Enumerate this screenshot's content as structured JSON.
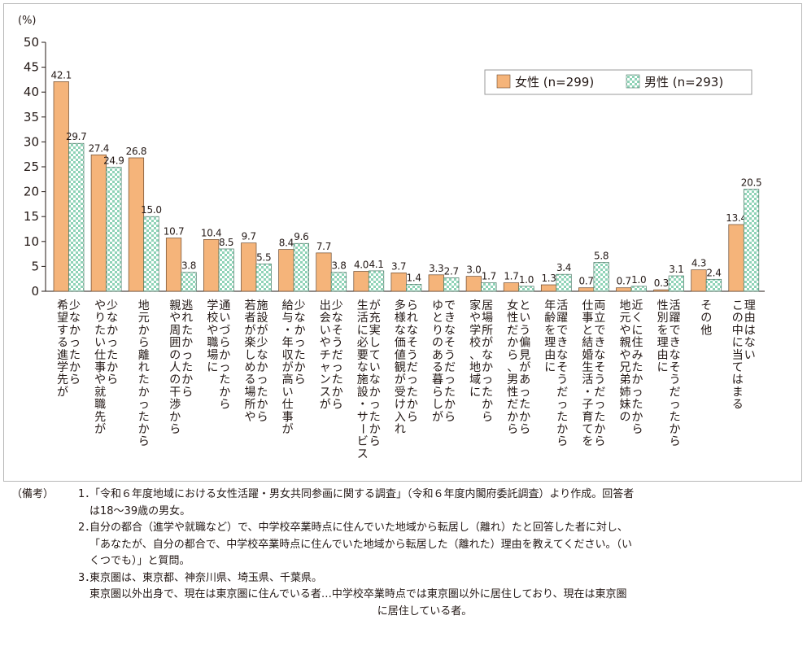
{
  "chart_data": {
    "type": "bar",
    "ylabel": "(%)",
    "ylim": [
      0,
      50
    ],
    "yticks": [
      0,
      5,
      10,
      15,
      20,
      25,
      30,
      35,
      40,
      45,
      50
    ],
    "categories": [
      [
        "少なかったから",
        "希望する進学先が"
      ],
      [
        "少なかったから",
        "やりたい仕事や就職先が"
      ],
      [
        "地元から離れたかったから"
      ],
      [
        "逃れたかったから",
        "親や周囲の人の干渉から"
      ],
      [
        "通いづらかったから",
        "学校や職場に"
      ],
      [
        "施設が少なかったから",
        "若者が楽しめる場所や"
      ],
      [
        "少なかったから",
        "給与・年収が高い仕事が"
      ],
      [
        "少なそうだったから",
        "出会いやチャンスが"
      ],
      [
        "が充実していなかったから",
        "生活に必要な施設・サービス"
      ],
      [
        "られなそうだったから",
        "多様な価値観が受け入れ"
      ],
      [
        "できなそうだったから",
        "ゆとりのある暮らしが"
      ],
      [
        "居場所がなかったから",
        "家や学校、地域に"
      ],
      [
        "という偏見があったから",
        "女性だから、男性だから"
      ],
      [
        "活躍できなそうだったから",
        "年齢を理由に"
      ],
      [
        "両立できなそうだったから",
        "仕事と結婚生活・子育てを"
      ],
      [
        "近くに住みたかったから",
        "地元や親や兄弟姉妹の"
      ],
      [
        "活躍できなそうだったから",
        "性別を理由に"
      ],
      [
        "その他"
      ],
      [
        "理由はない",
        "この中に当てはまる"
      ]
    ],
    "series": [
      {
        "name": "女性 (n=299)",
        "color": "#f5b47a",
        "values": [
          42.1,
          27.4,
          26.8,
          10.7,
          10.4,
          9.7,
          8.4,
          7.7,
          4.0,
          3.7,
          3.3,
          3.0,
          1.7,
          1.3,
          0.7,
          0.7,
          0.3,
          4.3,
          13.4
        ]
      },
      {
        "name": "男性 (n=293)",
        "color": "#8fd3b7",
        "values": [
          29.7,
          24.9,
          15.0,
          3.8,
          8.5,
          5.5,
          9.6,
          3.8,
          4.1,
          1.4,
          2.7,
          1.7,
          1.0,
          3.4,
          5.8,
          1.0,
          3.1,
          2.4,
          20.5
        ]
      }
    ],
    "value_labels": [
      [
        "42.1",
        "29.7"
      ],
      [
        "27.4",
        "24.9"
      ],
      [
        "26.8",
        "15.0"
      ],
      [
        "10.7",
        "3.8"
      ],
      [
        "10.4",
        "8.5"
      ],
      [
        "9.7",
        "5.5"
      ],
      [
        "8.4",
        "9.6"
      ],
      [
        "7.7",
        "3.8"
      ],
      [
        "4.0",
        "4.1"
      ],
      [
        "3.7",
        "1.4"
      ],
      [
        "3.3",
        "2.7"
      ],
      [
        "3.0",
        "1.7"
      ],
      [
        "1.7",
        "1.0"
      ],
      [
        "1.3",
        "3.4"
      ],
      [
        "0.7",
        "5.8"
      ],
      [
        "0.7",
        "1.0"
      ],
      [
        "0.3",
        "3.1"
      ],
      [
        "4.3",
        "2.4"
      ],
      [
        "13.4",
        "20.5"
      ]
    ],
    "legend_position": "top-right",
    "grid": false
  },
  "notes": {
    "prefix": "（備考）",
    "items": [
      {
        "num": "1．",
        "lines": [
          "「令和６年度地域における女性活躍・男女共同参画に関する調査」（令和６年度内閣府委託調査）より作成。回答者",
          "は18～39歳の男女。"
        ]
      },
      {
        "num": "2．",
        "lines": [
          "自分の都合（進学や就職など）で、中学校卒業時点に住んでいた地域から転居し（離れ）たと回答した者に対し、",
          "「あなたが、自分の都合で、中学校卒業時点に住んでいた地域から転居した（離れた）理由を教えてください。（い",
          "くつでも）」と質問。"
        ]
      },
      {
        "num": "3．",
        "lines": [
          "東京圏は、東京都、神奈川県、埼玉県、千葉県。",
          "東京圏以外出身で、現在は東京圏に住んでいる者…中学校卒業時点では東京圏以外に居住しており、現在は東京圏",
          "に居住している者。"
        ]
      }
    ]
  }
}
